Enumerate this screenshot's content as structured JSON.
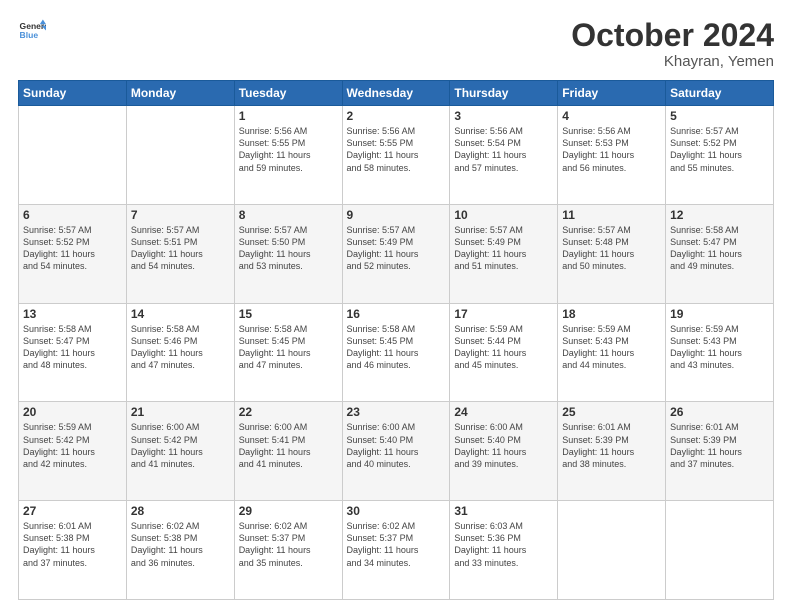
{
  "header": {
    "logo_line1": "General",
    "logo_line2": "Blue",
    "title": "October 2024",
    "subtitle": "Khayran, Yemen"
  },
  "weekdays": [
    "Sunday",
    "Monday",
    "Tuesday",
    "Wednesday",
    "Thursday",
    "Friday",
    "Saturday"
  ],
  "weeks": [
    [
      {
        "day": "",
        "info": ""
      },
      {
        "day": "",
        "info": ""
      },
      {
        "day": "1",
        "info": "Sunrise: 5:56 AM\nSunset: 5:55 PM\nDaylight: 11 hours\nand 59 minutes."
      },
      {
        "day": "2",
        "info": "Sunrise: 5:56 AM\nSunset: 5:55 PM\nDaylight: 11 hours\nand 58 minutes."
      },
      {
        "day": "3",
        "info": "Sunrise: 5:56 AM\nSunset: 5:54 PM\nDaylight: 11 hours\nand 57 minutes."
      },
      {
        "day": "4",
        "info": "Sunrise: 5:56 AM\nSunset: 5:53 PM\nDaylight: 11 hours\nand 56 minutes."
      },
      {
        "day": "5",
        "info": "Sunrise: 5:57 AM\nSunset: 5:52 PM\nDaylight: 11 hours\nand 55 minutes."
      }
    ],
    [
      {
        "day": "6",
        "info": "Sunrise: 5:57 AM\nSunset: 5:52 PM\nDaylight: 11 hours\nand 54 minutes."
      },
      {
        "day": "7",
        "info": "Sunrise: 5:57 AM\nSunset: 5:51 PM\nDaylight: 11 hours\nand 54 minutes."
      },
      {
        "day": "8",
        "info": "Sunrise: 5:57 AM\nSunset: 5:50 PM\nDaylight: 11 hours\nand 53 minutes."
      },
      {
        "day": "9",
        "info": "Sunrise: 5:57 AM\nSunset: 5:49 PM\nDaylight: 11 hours\nand 52 minutes."
      },
      {
        "day": "10",
        "info": "Sunrise: 5:57 AM\nSunset: 5:49 PM\nDaylight: 11 hours\nand 51 minutes."
      },
      {
        "day": "11",
        "info": "Sunrise: 5:57 AM\nSunset: 5:48 PM\nDaylight: 11 hours\nand 50 minutes."
      },
      {
        "day": "12",
        "info": "Sunrise: 5:58 AM\nSunset: 5:47 PM\nDaylight: 11 hours\nand 49 minutes."
      }
    ],
    [
      {
        "day": "13",
        "info": "Sunrise: 5:58 AM\nSunset: 5:47 PM\nDaylight: 11 hours\nand 48 minutes."
      },
      {
        "day": "14",
        "info": "Sunrise: 5:58 AM\nSunset: 5:46 PM\nDaylight: 11 hours\nand 47 minutes."
      },
      {
        "day": "15",
        "info": "Sunrise: 5:58 AM\nSunset: 5:45 PM\nDaylight: 11 hours\nand 47 minutes."
      },
      {
        "day": "16",
        "info": "Sunrise: 5:58 AM\nSunset: 5:45 PM\nDaylight: 11 hours\nand 46 minutes."
      },
      {
        "day": "17",
        "info": "Sunrise: 5:59 AM\nSunset: 5:44 PM\nDaylight: 11 hours\nand 45 minutes."
      },
      {
        "day": "18",
        "info": "Sunrise: 5:59 AM\nSunset: 5:43 PM\nDaylight: 11 hours\nand 44 minutes."
      },
      {
        "day": "19",
        "info": "Sunrise: 5:59 AM\nSunset: 5:43 PM\nDaylight: 11 hours\nand 43 minutes."
      }
    ],
    [
      {
        "day": "20",
        "info": "Sunrise: 5:59 AM\nSunset: 5:42 PM\nDaylight: 11 hours\nand 42 minutes."
      },
      {
        "day": "21",
        "info": "Sunrise: 6:00 AM\nSunset: 5:42 PM\nDaylight: 11 hours\nand 41 minutes."
      },
      {
        "day": "22",
        "info": "Sunrise: 6:00 AM\nSunset: 5:41 PM\nDaylight: 11 hours\nand 41 minutes."
      },
      {
        "day": "23",
        "info": "Sunrise: 6:00 AM\nSunset: 5:40 PM\nDaylight: 11 hours\nand 40 minutes."
      },
      {
        "day": "24",
        "info": "Sunrise: 6:00 AM\nSunset: 5:40 PM\nDaylight: 11 hours\nand 39 minutes."
      },
      {
        "day": "25",
        "info": "Sunrise: 6:01 AM\nSunset: 5:39 PM\nDaylight: 11 hours\nand 38 minutes."
      },
      {
        "day": "26",
        "info": "Sunrise: 6:01 AM\nSunset: 5:39 PM\nDaylight: 11 hours\nand 37 minutes."
      }
    ],
    [
      {
        "day": "27",
        "info": "Sunrise: 6:01 AM\nSunset: 5:38 PM\nDaylight: 11 hours\nand 37 minutes."
      },
      {
        "day": "28",
        "info": "Sunrise: 6:02 AM\nSunset: 5:38 PM\nDaylight: 11 hours\nand 36 minutes."
      },
      {
        "day": "29",
        "info": "Sunrise: 6:02 AM\nSunset: 5:37 PM\nDaylight: 11 hours\nand 35 minutes."
      },
      {
        "day": "30",
        "info": "Sunrise: 6:02 AM\nSunset: 5:37 PM\nDaylight: 11 hours\nand 34 minutes."
      },
      {
        "day": "31",
        "info": "Sunrise: 6:03 AM\nSunset: 5:36 PM\nDaylight: 11 hours\nand 33 minutes."
      },
      {
        "day": "",
        "info": ""
      },
      {
        "day": "",
        "info": ""
      }
    ]
  ]
}
